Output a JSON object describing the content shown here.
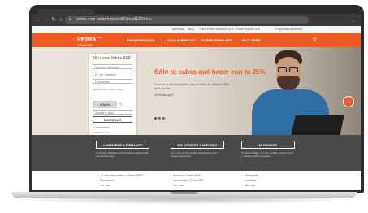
{
  "browser": {
    "url": "prima.com.pe/wcm/portal/PrimaAFP/Inicio",
    "back_glyph": "←",
    "forward_glyph": "→",
    "reload_glyph": "↻",
    "home_glyph": "⌂",
    "menu_glyph": "⋮"
  },
  "utility_bar": {
    "items": [
      "Agencias",
      "Blog",
      "Para Prima: Asesoría 615 - Prima Soporte 615",
      "Preguntas frecuentes"
    ]
  },
  "nav": {
    "logo": "PRIMA",
    "logo_sup": "AFP",
    "logo_sub": "Grupo Crédito",
    "items": [
      "PARA PERSONAS",
      "PARA EMPRESAS",
      "SOBRE PRIMA AFP",
      "MI CLIENTE"
    ],
    "search_glyph": "⚲"
  },
  "login": {
    "title": "Mi cuenta Prima AFP",
    "doc_type": "Tipo doc. identidad",
    "doc_number": "N° doc. identidad",
    "password": "Contraseña",
    "captcha_label": "Ingresa el texto de la imagen",
    "captcha_text": "r8h2rk",
    "refresh_glyph": "↻",
    "captcha_input": "Escribe el texto",
    "button": "INGRESAR",
    "remember": "☐ Recordarme",
    "forgot_1": "Olvidé mi clave",
    "forgot_2": "Cambié Prima AFP de contraseña"
  },
  "hero": {
    "headline": "Sólo tú sabes qué hacer con tu 25%",
    "subtext": "Conoce el procedimiento para el retiro de hasta el 25% de tu fondo",
    "link": "Infórmate aquí ›",
    "slides": 3,
    "active_slide": 0,
    "scroll_glyph": "⌄"
  },
  "band": {
    "cards": [
      {
        "label": "CAMBIARME A PRIMA AFP",
        "desc": "Si deseas cambiarte a Prima AFP, puedes iniciar tus trámites aquí."
      },
      {
        "label": "MIS APORTES Y MI FONDO",
        "desc": "Si ya eres de Prima AFP, accede aquí para revisar tus aportes."
      },
      {
        "label": "MI PENSIÓN",
        "desc": "Si estás jubilado o te vas a jubilar, conoce cómo y cuándo recibir tu pensión."
      }
    ]
  },
  "lists": {
    "col1": [
      "¿Cómo me cambio a Prima AFP?",
      "Beneficios",
      "Ver más"
    ],
    "col2": [
      "Nuevo en Prima AFP",
      "Aportando a Prima AFP",
      "Ver más"
    ],
    "col3": [
      "Jubilación",
      "Invalidez",
      "Ver más"
    ]
  },
  "colors": {
    "brand_orange": "#ee5a24",
    "band_gray": "#4a4a4a"
  }
}
